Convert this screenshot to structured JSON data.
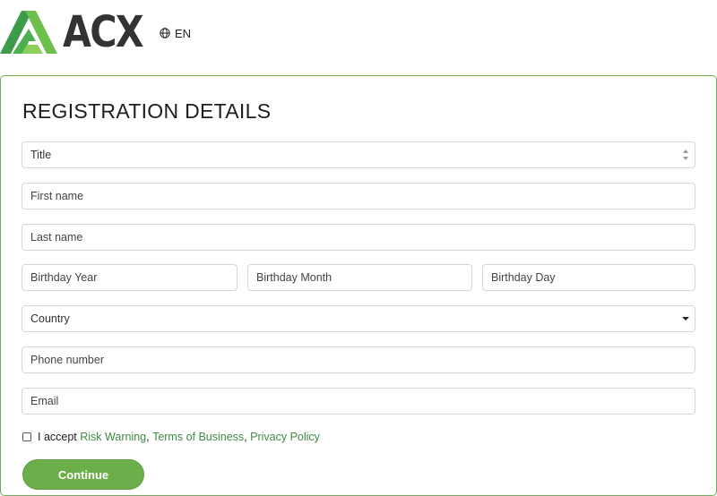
{
  "header": {
    "logo_text": "ACX",
    "language": "EN"
  },
  "form": {
    "title": "REGISTRATION DETAILS",
    "title_select": "Title",
    "first_name": "First name",
    "last_name": "Last name",
    "birthday_year": "Birthday Year",
    "birthday_month": "Birthday Month",
    "birthday_day": "Birthday Day",
    "country": "Country",
    "phone": "Phone number",
    "email": "Email"
  },
  "consent": {
    "prefix": "I accept ",
    "risk_warning": "Risk Warning",
    "sep1": ", ",
    "terms": "Terms of Business",
    "sep2": ", ",
    "privacy": "Privacy Policy"
  },
  "continue_label": "Continue",
  "colors": {
    "accent": "#6cae4a",
    "link": "#3f8a45",
    "logo_dark": "#333333"
  },
  "icons": {
    "logo": "acx-triangle-logo-icon",
    "language": "globe-icon"
  }
}
